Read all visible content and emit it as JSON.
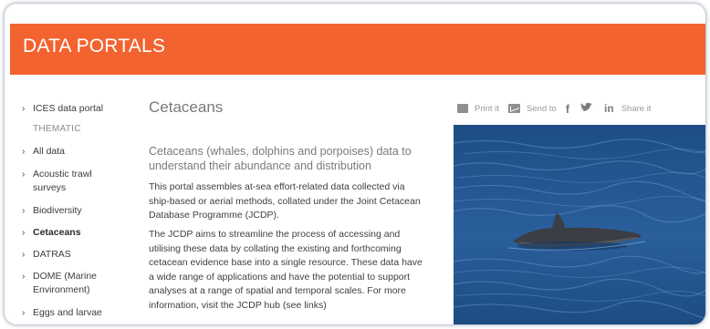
{
  "header": {
    "title": "DATA PORTALS"
  },
  "sidebar": {
    "items": [
      {
        "label": "ICES data portal",
        "active": false
      },
      {
        "label": "THEMATIC",
        "heading": true
      },
      {
        "label": "All data",
        "active": false
      },
      {
        "label": "Acoustic trawl surveys",
        "active": false
      },
      {
        "label": "Biodiversity",
        "active": false
      },
      {
        "label": "Cetaceans",
        "active": true
      },
      {
        "label": "DATRAS",
        "active": false
      },
      {
        "label": "DOME (Marine Environment)",
        "active": false
      },
      {
        "label": "Eggs and larvae",
        "active": false
      }
    ]
  },
  "main": {
    "title": "Cetaceans",
    "subtitle": "Cetaceans (whales, dolphins and porpoises) data to understand their abundance and distribution",
    "paragraph1": "This portal assembles at-sea effort-related data collected via ship-based or aerial methods, collated under the Joint Cetacean Database Programme (JCDP).",
    "paragraph2": "The JCDP aims to streamline the process of accessing and utilising these data by collating the existing and forthcoming cetacean evidence base into a single resource. These data have a wide range of applications and have the potential to support analyses at a range of spatial and temporal scales. For more information, visit the JCDP hub (see links)"
  },
  "share": {
    "print_label": "Print it",
    "send_label": "Send to",
    "facebook": "f",
    "linkedin": "in",
    "share_label": "Share it"
  },
  "colors": {
    "banner": "#f26330",
    "water": "#1f4f86"
  },
  "icons": [
    "chevron-right-icon",
    "print-icon",
    "mail-icon",
    "facebook-icon",
    "twitter-icon",
    "linkedin-icon"
  ]
}
